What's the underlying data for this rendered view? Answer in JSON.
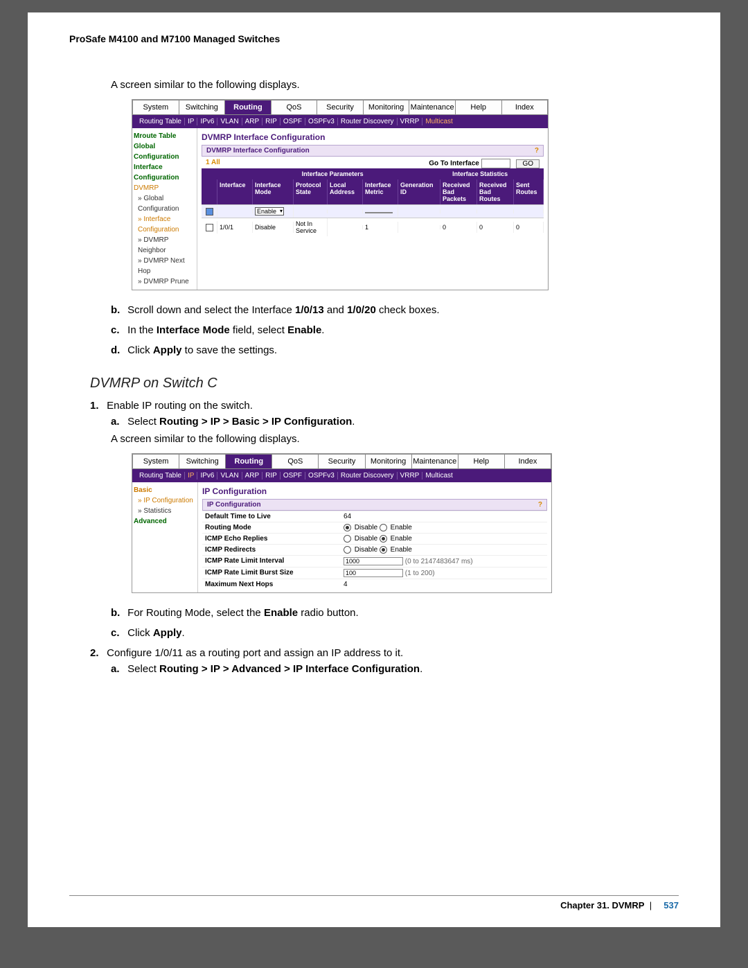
{
  "doc": {
    "header": "ProSafe M4100 and M7100 Managed Switches",
    "intro_line": "A screen similar to the following displays.",
    "steps_after_ss1": {
      "b": "Scroll down and select the Interface ",
      "b_bold1": "1/0/13",
      "b_mid": " and ",
      "b_bold2": "1/0/20",
      "b_end": " check boxes.",
      "c_pre": "In the ",
      "c_bold1": "Interface Mode",
      "c_mid": " field, select ",
      "c_bold2": "Enable",
      "c_end": ".",
      "d_pre": "Click ",
      "d_bold": "Apply",
      "d_end": " to save the settings."
    },
    "section_title": "DVMRP on Switch C",
    "switchC": {
      "s1": "Enable IP routing on the switch.",
      "s1a_pre": "Select ",
      "s1a_bold": "Routing > IP > Basic > IP Configuration",
      "s1a_end": ".",
      "s1a_line2": "A screen similar to the following displays.",
      "s1b_pre": "For Routing Mode, select the ",
      "s1b_bold": "Enable",
      "s1b_end": " radio button.",
      "s1c_pre": "Click ",
      "s1c_bold": "Apply",
      "s1c_end": ".",
      "s2": "Configure 1/0/11 as a routing port and assign an IP address to it.",
      "s2a_pre": "Select ",
      "s2a_bold": "Routing > IP > Advanced > IP Interface Configuration",
      "s2a_end": "."
    },
    "footer_chapter": "Chapter 31.  DVMRP",
    "footer_page": "537"
  },
  "ss1": {
    "tabs": [
      "System",
      "Switching",
      "Routing",
      "QoS",
      "Security",
      "Monitoring",
      "Maintenance",
      "Help",
      "Index"
    ],
    "active_tab": "Routing",
    "subtabs": [
      "Routing Table",
      "IP",
      "IPv6",
      "VLAN",
      "ARP",
      "RIP",
      "OSPF",
      "OSPFv3",
      "Router Discovery",
      "VRRP",
      "Multicast"
    ],
    "active_subtab": "Multicast",
    "side": {
      "items": [
        {
          "label": "Mroute Table",
          "cls": "group"
        },
        {
          "label": "Global",
          "cls": "group"
        },
        {
          "label": "Configuration",
          "cls": "group"
        },
        {
          "label": "Interface",
          "cls": "group"
        },
        {
          "label": "Configuration",
          "cls": "group"
        },
        {
          "label": "DVMRP",
          "cls": "sel"
        },
        {
          "label": "» Global",
          "cls": "item"
        },
        {
          "label": "  Configuration",
          "cls": "item"
        },
        {
          "label": "» Interface",
          "cls": "item sel"
        },
        {
          "label": "  Configuration",
          "cls": "item sel"
        },
        {
          "label": "» DVMRP Neighbor",
          "cls": "item"
        },
        {
          "label": "» DVMRP Next Hop",
          "cls": "item"
        },
        {
          "label": "» DVMRP Prune",
          "cls": "item"
        }
      ]
    },
    "pane": {
      "title": "DVMRP Interface Configuration",
      "strip": "DVMRP Interface Configuration",
      "all": "1  All",
      "goto": "Go To Interface",
      "go": "GO",
      "grouphdrs": [
        "Interface Parameters",
        "Interface Statistics"
      ],
      "cols": [
        "",
        "Interface",
        "Interface Mode",
        "Protocol State",
        "Local Address",
        "Interface Metric",
        "Generation ID",
        "Received Bad Packets",
        "Received Bad Routes",
        "Sent Routes"
      ],
      "row0": {
        "mode": "Enable"
      },
      "row1": {
        "if": "1/0/1",
        "mode": "Disable",
        "ps": "Not In Service",
        "la": "",
        "me": "1",
        "gi": "",
        "bp": "0",
        "br": "0",
        "sr": "0"
      }
    }
  },
  "ss2": {
    "tabs": [
      "System",
      "Switching",
      "Routing",
      "QoS",
      "Security",
      "Monitoring",
      "Maintenance",
      "Help",
      "Index"
    ],
    "active_tab": "Routing",
    "subtabs": [
      "Routing Table",
      "IP",
      "IPv6",
      "VLAN",
      "ARP",
      "RIP",
      "OSPF",
      "OSPFv3",
      "Router Discovery",
      "VRRP",
      "Multicast"
    ],
    "active_subtab": "IP",
    "side": {
      "items": [
        {
          "label": "Basic",
          "cls": "sel group"
        },
        {
          "label": "» IP Configuration",
          "cls": "item sel"
        },
        {
          "label": "» Statistics",
          "cls": "item"
        },
        {
          "label": "Advanced",
          "cls": "group"
        }
      ]
    },
    "pane": {
      "title": "IP Configuration",
      "strip": "IP Configuration",
      "rows": [
        {
          "lbl": "Default Time to Live",
          "val": "64",
          "type": "text"
        },
        {
          "lbl": "Routing Mode",
          "val": "radio",
          "d": "Disable",
          "e": "Enable",
          "sel": "d"
        },
        {
          "lbl": "ICMP Echo Replies",
          "val": "radio",
          "d": "Disable",
          "e": "Enable",
          "sel": "e"
        },
        {
          "lbl": "ICMP Redirects",
          "val": "radio",
          "d": "Disable",
          "e": "Enable",
          "sel": "e"
        },
        {
          "lbl": "ICMP Rate Limit Interval",
          "val": "1000",
          "type": "input",
          "hint": "(0 to 2147483647 ms)"
        },
        {
          "lbl": "ICMP Rate Limit Burst Size",
          "val": "100",
          "type": "input",
          "hint": "(1 to 200)"
        },
        {
          "lbl": "Maximum Next Hops",
          "val": "4",
          "type": "text"
        }
      ]
    }
  }
}
